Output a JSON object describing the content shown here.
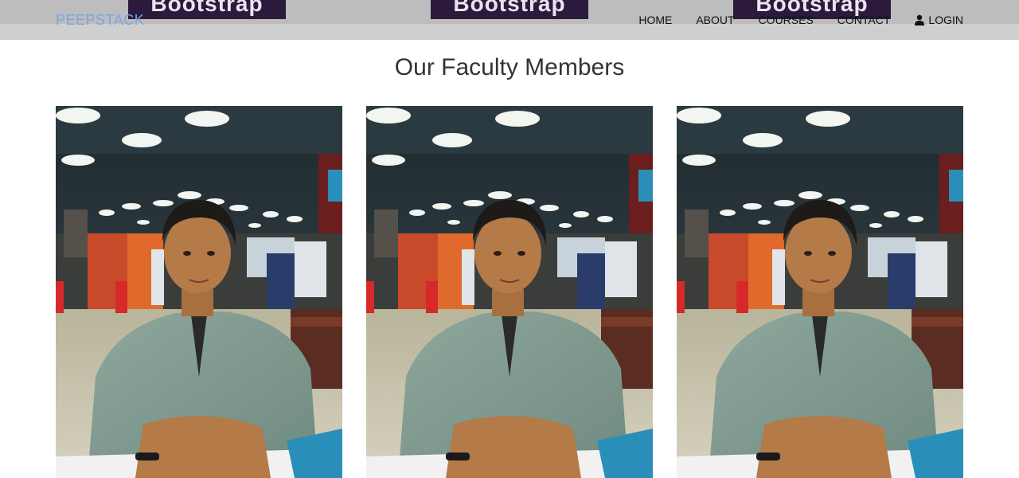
{
  "banner": {
    "text": "Bootstrap"
  },
  "brand": {
    "label": "PEEPSTACK"
  },
  "nav": {
    "items": [
      {
        "label": "HOME"
      },
      {
        "label": "ABOUT"
      },
      {
        "label": "COURSES"
      },
      {
        "label": "CONTACT"
      }
    ],
    "login": {
      "label": "LOGIN",
      "icon": "user-icon"
    }
  },
  "section": {
    "title": "Our Faculty Members"
  },
  "faculty": [
    {
      "photo": "faculty-photo"
    },
    {
      "photo": "faculty-photo"
    },
    {
      "photo": "faculty-photo"
    }
  ],
  "colors": {
    "brand": "#7aa5e6",
    "topbar": "#bdbdbd",
    "banner": "#2b1a3c",
    "heading": "#333333"
  }
}
